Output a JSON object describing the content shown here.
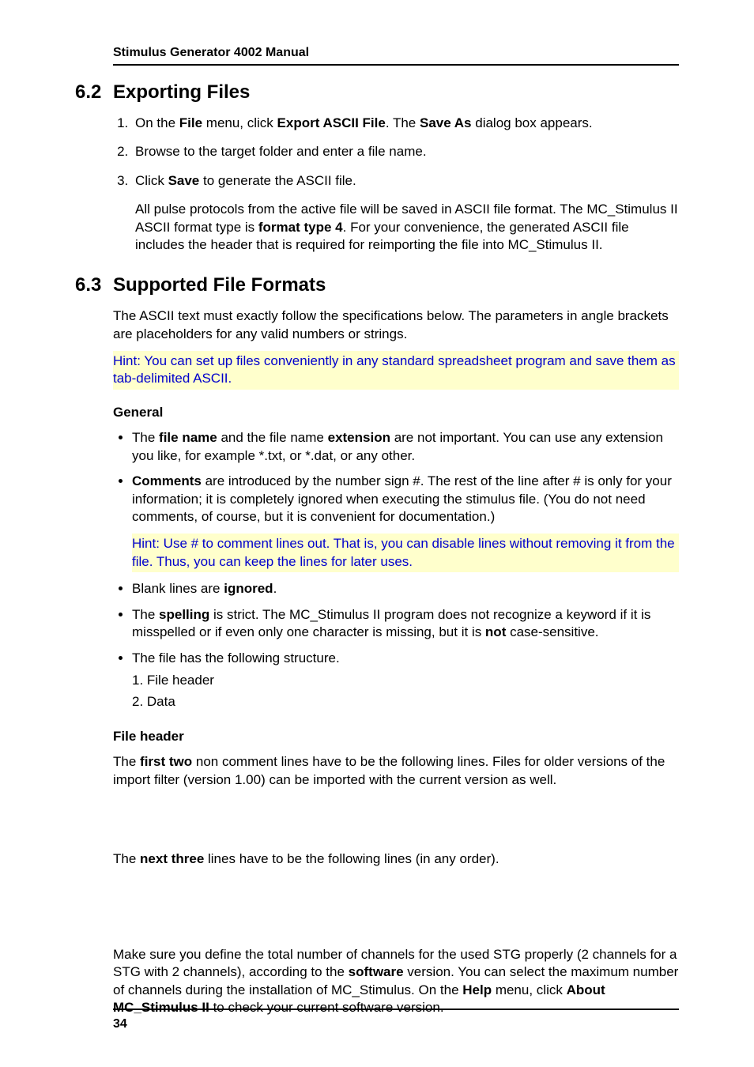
{
  "running_head": "Stimulus Generator 4002 Manual",
  "sec62": {
    "num": "6.2",
    "title": "Exporting Files",
    "li1_a": "On the ",
    "li1_b": "File",
    "li1_c": " menu, click ",
    "li1_d": "Export ASCII File",
    "li1_e": ". The ",
    "li1_f": "Save As",
    "li1_g": " dialog box appears.",
    "li2": "Browse to the target folder and enter a file name.",
    "li3_a": "Click ",
    "li3_b": "Save",
    "li3_c": " to generate the ASCII file.",
    "li3_p_a": "All pulse protocols from the active file will be saved in ASCII file format. The MC_Stimulus II ASCII format type is ",
    "li3_p_b": "format type 4",
    "li3_p_c": ". For your convenience, the generated ASCII file includes the header that is required for reimporting the file into MC_Stimulus II."
  },
  "sec63": {
    "num": "6.3",
    "title": "Supported File Formats",
    "intro": "The ASCII text must exactly follow the specifications below. The parameters in angle brackets are placeholders for any valid numbers or strings.",
    "hint1": "Hint: You can set up files conveniently in any standard spreadsheet program and save them as tab-delimited ASCII.",
    "general_head": "General",
    "b1_a": "The ",
    "b1_b": "file name",
    "b1_c": " and the file name ",
    "b1_d": "extension",
    "b1_e": " are not important. You can use any extension you like, for example *.txt, or *.dat, or any other.",
    "b2_a": "Comments",
    "b2_b": " are introduced by the number sign #. The rest of the line after # is only for your information; it is completely ignored when executing the stimulus file. (You do not need comments, of course, but it is convenient for documentation.)",
    "hint2": "Hint: Use # to comment lines out. That is, you can disable lines without removing it from the file. Thus, you can keep the lines for later uses.",
    "b3_a": "Blank lines are ",
    "b3_b": "ignored",
    "b3_c": ".",
    "b4_a": "The ",
    "b4_b": "spelling",
    "b4_c": " is strict. The MC_Stimulus II program does not recognize a keyword if it is misspelled or if even only one character is missing, but it is ",
    "b4_d": "not",
    "b4_e": " case-sensitive.",
    "b5": "The file has the following structure.",
    "b5_s1": "1. File header",
    "b5_s2": "2. Data",
    "fh_head": "File header",
    "fh_p1_a": "The ",
    "fh_p1_b": "first two",
    "fh_p1_c": " non comment lines have to be the following lines. Files for older versions of the import filter (version 1.00) can be imported with the current version as well.",
    "fh_p2_a": "The ",
    "fh_p2_b": "next three",
    "fh_p2_c": " lines have to be the following lines (in any order).",
    "fh_p3_a": "Make sure you define the total number of channels for the used STG properly (2 channels for a STG with 2 channels), according to the ",
    "fh_p3_b": "software",
    "fh_p3_c": " version. You can select the maximum number of channels during the installation of MC_Stimulus. On the ",
    "fh_p3_d": "Help",
    "fh_p3_e": " menu, click ",
    "fh_p3_f": "About MC_Stimulus II",
    "fh_p3_g": " to check your current software version."
  },
  "page_number": "34"
}
